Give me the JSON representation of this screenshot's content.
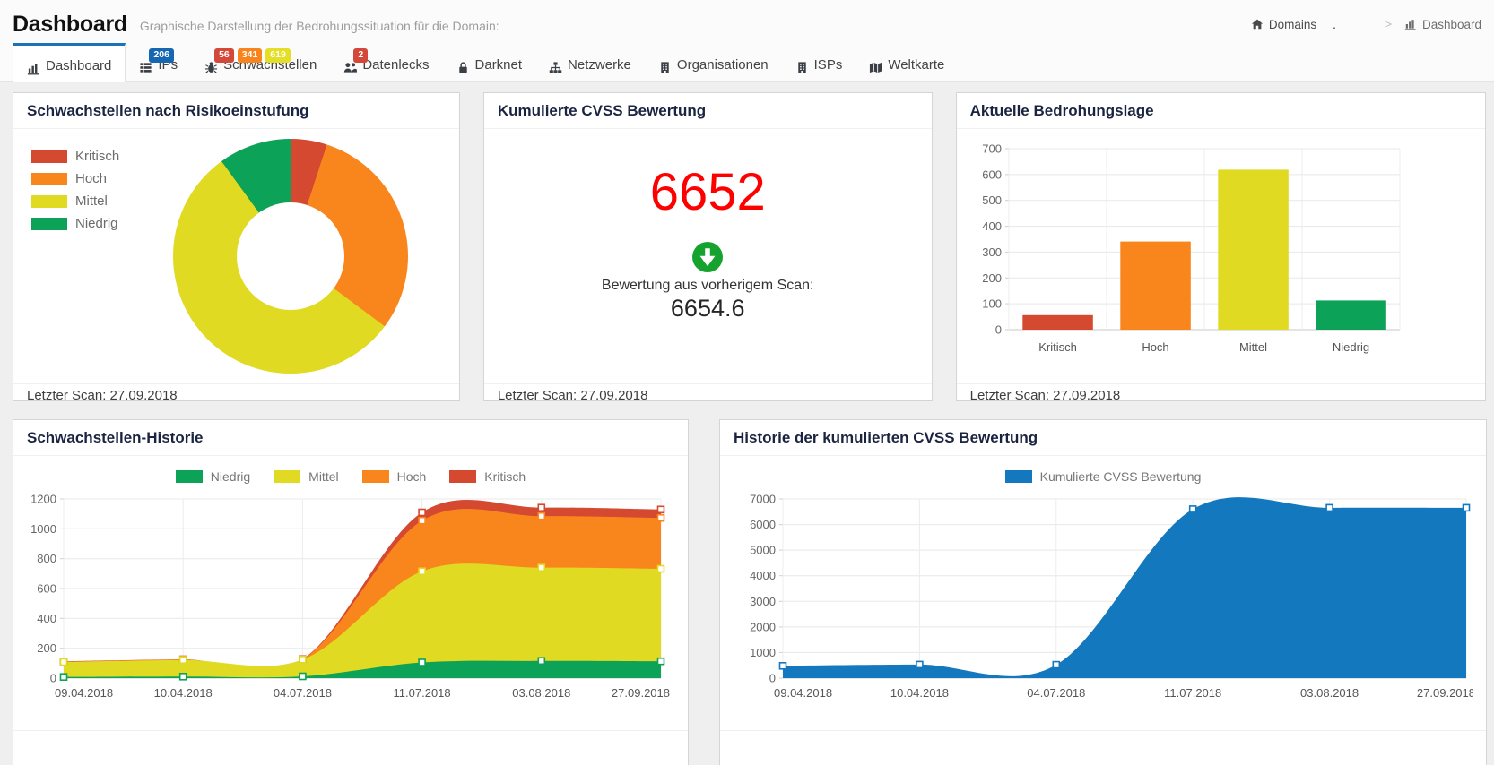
{
  "header": {
    "title": "Dashboard",
    "subtitle": "Graphische Darstellung der Bedrohungssituation für die Domain:"
  },
  "breadcrumb": {
    "domains": "Domains",
    "domains_icon": "home",
    "redacted": ".",
    "separator": ">",
    "current": "Dashboard",
    "current_icon": "chart-bar"
  },
  "tabs": [
    {
      "label": "Dashboard",
      "icon": "chart-bar",
      "active": true,
      "badges": []
    },
    {
      "label": "IPs",
      "icon": "list",
      "active": false,
      "badges": [
        {
          "text": "206",
          "color": "#1567b2"
        }
      ]
    },
    {
      "label": "Schwachstellen",
      "icon": "bug",
      "active": false,
      "badges": [
        {
          "text": "56",
          "color": "#d4483a"
        },
        {
          "text": "341",
          "color": "#f8841d"
        },
        {
          "text": "619",
          "color": "#e4de25"
        }
      ]
    },
    {
      "label": "Datenlecks",
      "icon": "users",
      "active": false,
      "badges": [
        {
          "text": "2",
          "color": "#d4483a"
        }
      ]
    },
    {
      "label": "Darknet",
      "icon": "lock",
      "active": false,
      "badges": []
    },
    {
      "label": "Netzwerke",
      "icon": "sitemap",
      "active": false,
      "badges": []
    },
    {
      "label": "Organisationen",
      "icon": "building",
      "active": false,
      "badges": []
    },
    {
      "label": "ISPs",
      "icon": "building",
      "active": false,
      "badges": []
    },
    {
      "label": "Weltkarte",
      "icon": "map",
      "active": false,
      "badges": []
    }
  ],
  "cards": {
    "risk": {
      "title": "Schwachstellen nach Risikoeinstufung",
      "footer": "Letzter Scan: 27.09.2018"
    },
    "cvss": {
      "title": "Kumulierte CVSS Bewertung",
      "value": "6652",
      "value_color": "#ff0000",
      "icon": "arrow-circle-down",
      "icon_color": "#16a32d",
      "label": "Bewertung aus vorherigem Scan:",
      "previous": "6654.6",
      "footer": "Letzter Scan: 27.09.2018"
    },
    "threat": {
      "title": "Aktuelle Bedrohungslage",
      "footer": "Letzter Scan: 27.09.2018"
    },
    "history": {
      "title": "Schwachstellen-Historie"
    },
    "cvss_history": {
      "title": "Historie der kumulierten CVSS Bewertung"
    }
  },
  "colors": {
    "kritisch": "#d4492f",
    "hoch": "#f8861d",
    "mittel": "#e0da22",
    "niedrig": "#0ca258",
    "blue": "#1478be",
    "tab_accent": "#1a72b8"
  },
  "chart_data": [
    {
      "id": "risk_donut",
      "type": "pie",
      "donut": true,
      "labels": [
        "Kritisch",
        "Hoch",
        "Mittel",
        "Niedrig"
      ],
      "values": [
        56,
        341,
        619,
        113
      ],
      "colors": [
        "#d4492f",
        "#f8861d",
        "#e0da22",
        "#0ca258"
      ],
      "legend_position": "left"
    },
    {
      "id": "threat_bar",
      "type": "bar",
      "categories": [
        "Kritisch",
        "Hoch",
        "Mittel",
        "Niedrig"
      ],
      "values": [
        56,
        341,
        619,
        113
      ],
      "colors": [
        "#d4492f",
        "#f8861d",
        "#e0da22",
        "#0ca258"
      ],
      "ylim": [
        0,
        700
      ],
      "ystep": 100,
      "grid": true
    },
    {
      "id": "vuln_history",
      "type": "area",
      "stacked": true,
      "x": [
        "09.04.2018",
        "10.04.2018",
        "04.07.2018",
        "11.07.2018",
        "03.08.2018",
        "27.09.2018"
      ],
      "series": [
        {
          "name": "Niedrig",
          "color": "#0ca258",
          "values": [
            8,
            10,
            12,
            105,
            115,
            113
          ]
        },
        {
          "name": "Mittel",
          "color": "#e0da22",
          "values": [
            100,
            112,
            112,
            610,
            625,
            619
          ]
        },
        {
          "name": "Hoch",
          "color": "#f8861d",
          "values": [
            2,
            2,
            2,
            340,
            345,
            341
          ]
        },
        {
          "name": "Kritisch",
          "color": "#d4492f",
          "values": [
            2,
            2,
            2,
            55,
            57,
            56
          ]
        }
      ],
      "ylim": [
        0,
        1200
      ],
      "ystep": 200,
      "legend_position": "top"
    },
    {
      "id": "cvss_history",
      "type": "area",
      "stacked": false,
      "x": [
        "09.04.2018",
        "10.04.2018",
        "04.07.2018",
        "11.07.2018",
        "03.08.2018",
        "27.09.2018"
      ],
      "series": [
        {
          "name": "Kumulierte CVSS Bewertung",
          "color": "#1478be",
          "values": [
            480,
            530,
            520,
            6600,
            6655,
            6652
          ]
        }
      ],
      "ylim": [
        0,
        7000
      ],
      "ystep": 1000,
      "legend_position": "top"
    }
  ]
}
